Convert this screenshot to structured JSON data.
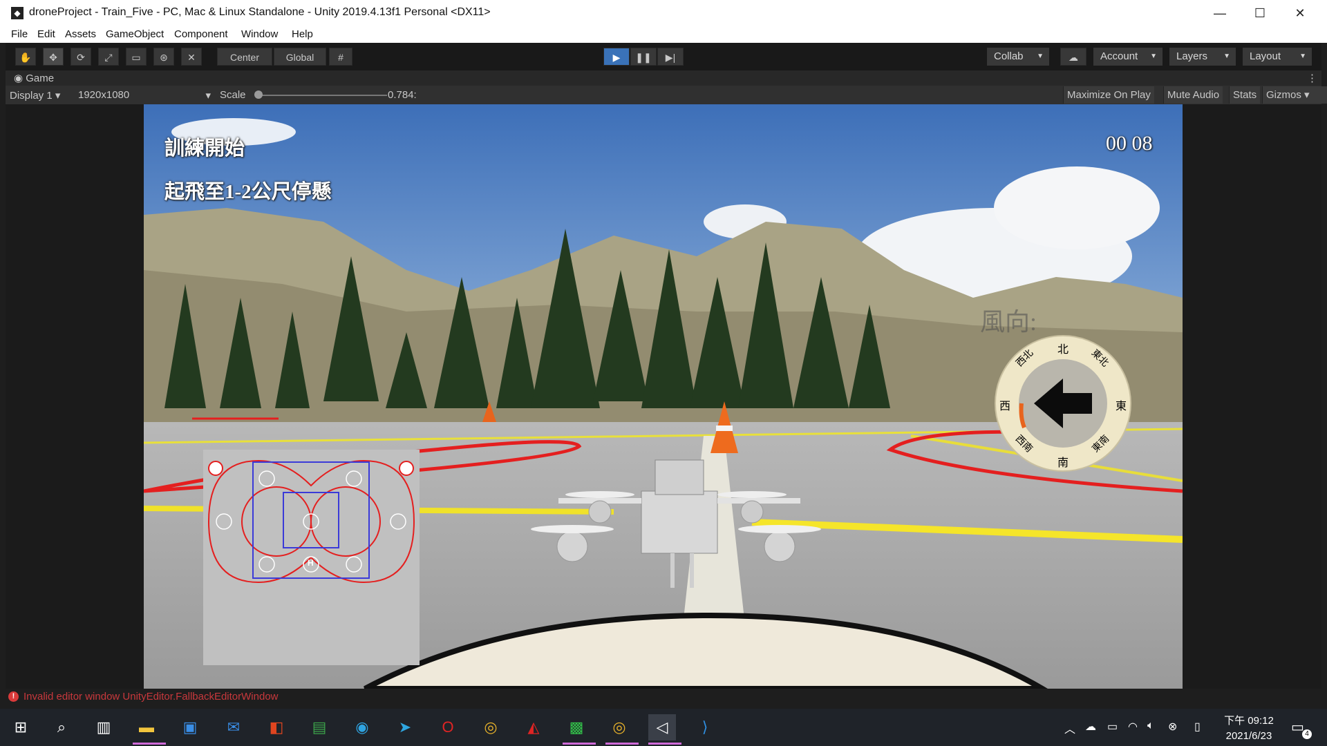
{
  "window": {
    "title": "droneProject - Train_Five - PC, Mac & Linux Standalone - Unity 2019.4.13f1 Personal <DX11>",
    "minimize": "—",
    "maximize": "☐",
    "close": "✕"
  },
  "menu": [
    "File",
    "Edit",
    "Assets",
    "GameObject",
    "Component",
    "Window",
    "Help"
  ],
  "toolbar": {
    "tools": [
      "hand-tool",
      "move-tool",
      "rotate-tool",
      "scale-tool",
      "rect-tool",
      "transform-tool",
      "custom-tool"
    ],
    "pivot": "Center",
    "space": "Global",
    "collab": "Collab",
    "account": "Account",
    "layers": "Layers",
    "layout": "Layout"
  },
  "game_view": {
    "tab": "Game",
    "display": "Display 1",
    "resolution": "1920x1080",
    "scale_label": "Scale",
    "scale_value": "0.784:",
    "maximize_on_play": "Maximize On Play",
    "mute_audio": "Mute Audio",
    "stats": "Stats",
    "gizmos": "Gizmos"
  },
  "hud": {
    "status_line1": "訓練開始",
    "status_line2": "起飛至1-2公尺停懸",
    "timer": "00 08",
    "wind_label": "風向:",
    "compass": [
      "北",
      "東北",
      "東",
      "東南",
      "南",
      "西南",
      "西",
      "西北"
    ],
    "minimap_h": "H"
  },
  "status_bar": {
    "message": "Invalid editor window UnityEditor.FallbackEditorWindow"
  },
  "taskbar": {
    "apps": [
      "start",
      "search",
      "task-view",
      "file-explorer",
      "store",
      "mail",
      "office",
      "excel",
      "edge",
      "telegram",
      "opera",
      "chrome",
      "garena",
      "line",
      "chrome-2",
      "unity",
      "vscode"
    ],
    "time": "下午 09:12",
    "date": "2021/6/23",
    "notifications": "4"
  },
  "colors": {
    "play_blue": "#3a72b8",
    "error_red": "#c8383c",
    "compass_cream": "#efe7c8"
  }
}
